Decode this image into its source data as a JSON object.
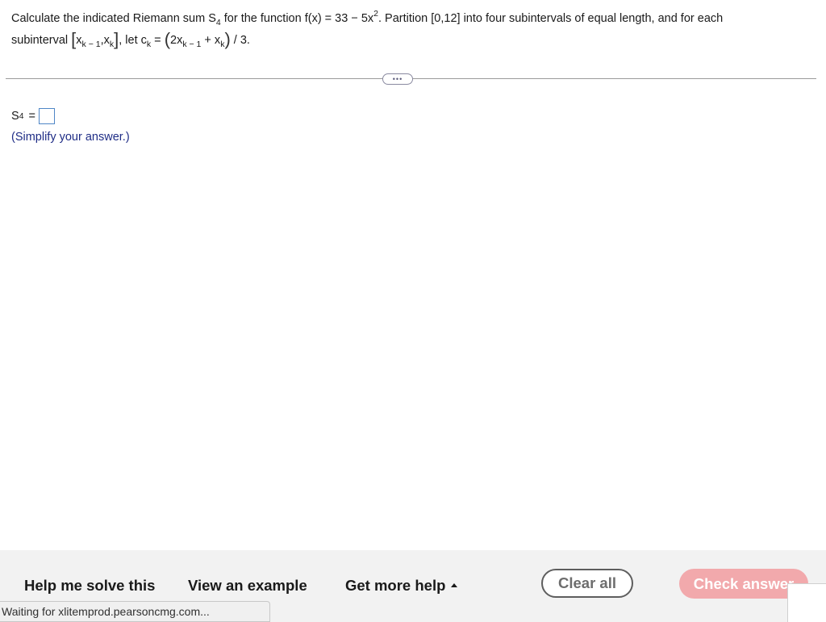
{
  "question": {
    "part1": "Calculate the indicated Riemann sum S",
    "sum_sub": "4",
    "part2": " for the function f(x) = 33 − 5x",
    "exp": "2",
    "part3": ". Partition [0,12] into four subintervals of equal length, and for each",
    "subinterval_text": "subinterval ",
    "bracket_open": "[",
    "x1": "x",
    "x1_sub": "k − 1",
    "comma": ",",
    "x2": "x",
    "x2_sub": "k",
    "bracket_close": "]",
    "let_text": ", let c",
    "c_sub": "k",
    "equals": " = ",
    "paren_open": "(",
    "two_x": "2x",
    "two_x_sub": "k − 1",
    "plus_x": " + x",
    "plus_x_sub": "k",
    "paren_close": ")",
    "div_text": " / 3."
  },
  "more_button": {
    "label": "•••"
  },
  "answer": {
    "label": "S",
    "label_sub": "4",
    "equals": "=",
    "value": ""
  },
  "hint": "(Simplify your answer.)",
  "footer": {
    "help_solve": "Help me solve this",
    "view_example": "View an example",
    "get_more_help": "Get more help",
    "clear_all": "Clear all",
    "check_answer": "Check answer"
  },
  "status_bar": "Waiting for xlitemprod.pearsoncmg.com...",
  "colors": {
    "hint": "#1f2d86",
    "answer_box_border": "#4f86c6",
    "check_button_bg": "#f2a9ac",
    "footer_bg": "#f2f2f2"
  }
}
